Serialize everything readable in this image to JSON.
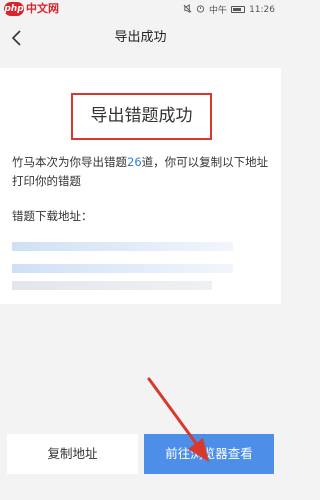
{
  "status_bar": {
    "logo_badge": "php",
    "logo_text": "中文网",
    "carrier": "中午",
    "time": "11:26",
    "icons": [
      "mute-icon",
      "alarm-icon",
      "battery-icon"
    ]
  },
  "header": {
    "title": "导出成功",
    "back_icon": "chevron-left-icon"
  },
  "result": {
    "heading": "导出错题成功",
    "message_prefix": "竹马本次为你导出错题",
    "count": "26",
    "message_suffix": "道，你可以复制以下地址打印你的错题",
    "link_label": "错题下载地址："
  },
  "actions": {
    "copy_label": "复制地址",
    "open_label": "前往浏览器查看"
  },
  "colors": {
    "accent": "#4d8fe8",
    "highlight_border": "#d8392c",
    "count_color": "#2f7fd3",
    "annotation_arrow": "#d8392c"
  }
}
